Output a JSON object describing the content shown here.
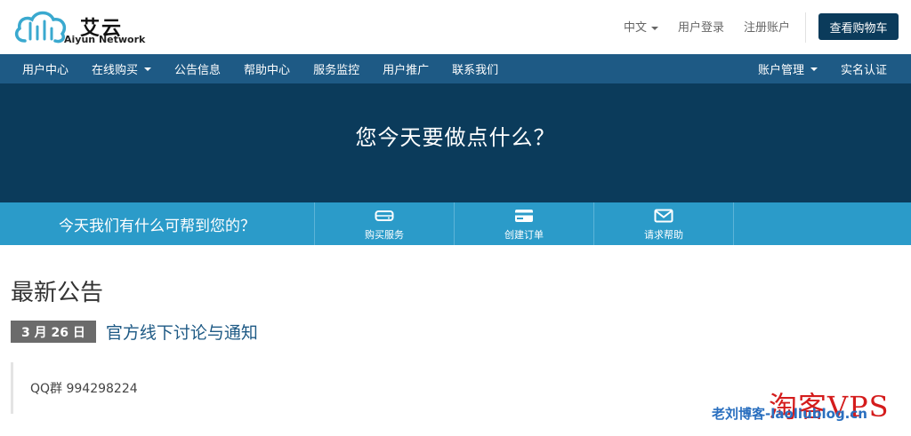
{
  "brand": {
    "name_cn": "艾云",
    "name_en": "Aiyun Network",
    "color_primary": "#0b3b5b",
    "color_nav": "#1e5a85",
    "color_accent": "#2b9bc9"
  },
  "top_links": {
    "language": "中文",
    "login": "用户登录",
    "register": "注册账户",
    "cart": "查看购物车"
  },
  "nav": {
    "left": [
      {
        "label": "用户中心",
        "dropdown": false
      },
      {
        "label": "在线购买",
        "dropdown": true
      },
      {
        "label": "公告信息",
        "dropdown": false
      },
      {
        "label": "帮助中心",
        "dropdown": false
      },
      {
        "label": "服务监控",
        "dropdown": false
      },
      {
        "label": "用户推广",
        "dropdown": false
      },
      {
        "label": "联系我们",
        "dropdown": false
      }
    ],
    "right": [
      {
        "label": "账户管理",
        "dropdown": true
      },
      {
        "label": "实名认证",
        "dropdown": false
      }
    ]
  },
  "hero": {
    "title": "您今天要做点什么？"
  },
  "action_bar": {
    "question": "今天我们有什么可帮到您的？",
    "actions": [
      {
        "label": "购买服务",
        "icon": "server-icon"
      },
      {
        "label": "创建订单",
        "icon": "credit-card-icon"
      },
      {
        "label": "请求帮助",
        "icon": "envelope-icon"
      }
    ]
  },
  "announcements": {
    "section_title": "最新公告",
    "items": [
      {
        "date": "3 月 26 日",
        "title": "官方线下讨论与通知",
        "body": "QQ群 994298224"
      }
    ]
  },
  "watermark": {
    "text_cn": "淘客VPS",
    "text_en": "老刘博客-laoliublog.cn"
  }
}
